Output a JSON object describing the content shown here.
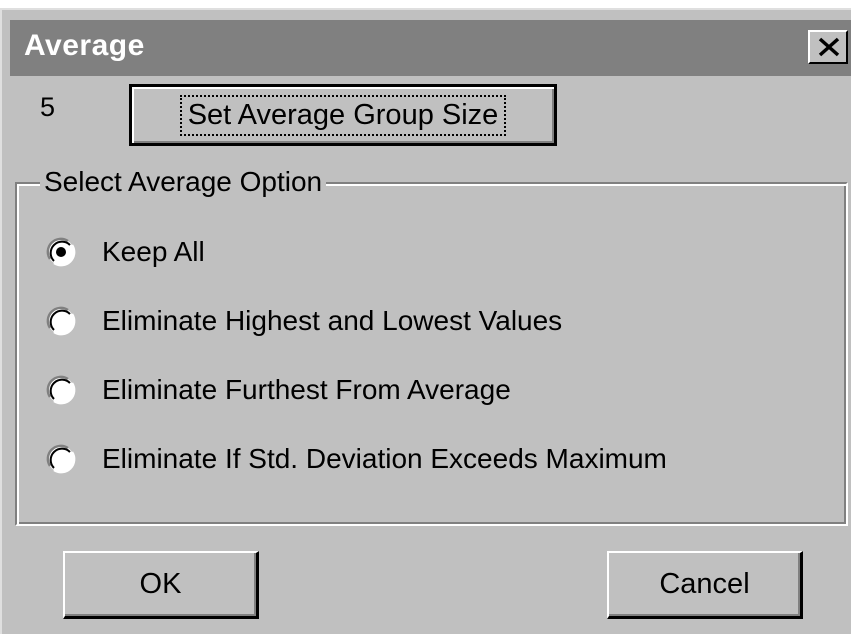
{
  "window": {
    "title": "Average",
    "close_symbol": "X"
  },
  "group_size": {
    "value": "5",
    "button_label": "Set Average Group Size"
  },
  "average_option": {
    "legend": "Select Average Option",
    "options": [
      {
        "label": "Keep All",
        "selected": true
      },
      {
        "label": "Eliminate Highest and Lowest Values",
        "selected": false
      },
      {
        "label": "Eliminate Furthest From Average",
        "selected": false
      },
      {
        "label": "Eliminate If Std. Deviation Exceeds Maximum",
        "selected": false
      }
    ]
  },
  "buttons": {
    "ok_label": "OK",
    "cancel_label": "Cancel"
  },
  "colors": {
    "face": "#c0c0c0",
    "titlebar": "#808080",
    "highlight": "#ffffff",
    "shadow": "#808080",
    "dark_shadow": "#000000"
  }
}
